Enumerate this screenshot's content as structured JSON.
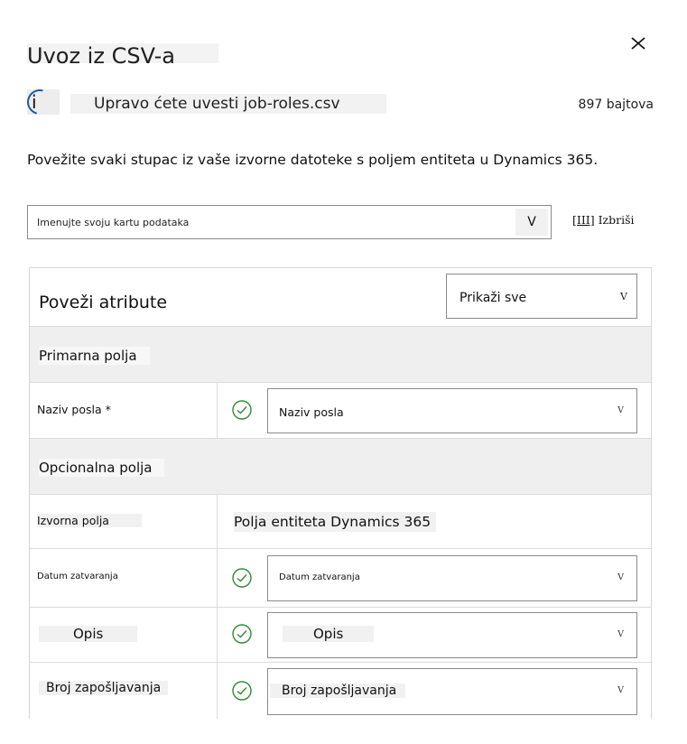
{
  "dialog": {
    "title": "Uvoz iz CSV-a",
    "file_note": "Upravo ćete uvesti job-roles.csv",
    "file_size": "897 bajtova",
    "info_icon_letter": "i",
    "instruction": "Povežite svaki stupac iz vaše izvorne datoteke s poljem entiteta u Dynamics 365."
  },
  "map_name": {
    "placeholder": "Imenujte svoju kartu podataka",
    "chevron": "V"
  },
  "delete": {
    "icon_text": "[III]",
    "label": "Izbriši"
  },
  "panel": {
    "title": "Poveži atribute",
    "show_select": {
      "value": "Prikaži sve",
      "chevron": "V"
    },
    "primary_section": "Primarna polja",
    "optional_section": "Opcionalna polja",
    "column_headers": {
      "source": "Izvorna polja",
      "target": "Polja entiteta Dynamics 365"
    },
    "rows": [
      {
        "source": "Naziv posla *",
        "target": "Naziv posla",
        "chevron": "V"
      },
      {
        "source": "Datum zatvaranja",
        "target": "Datum zatvaranja",
        "chevron": "V"
      },
      {
        "source": "Opis",
        "target": "Opis",
        "chevron": "V"
      },
      {
        "source": "Broj zapošljavanja",
        "target": "Broj zapošljavanja",
        "chevron": "V"
      }
    ]
  },
  "colors": {
    "accent": "#1c5aa6",
    "success": "#2e8b35",
    "border": "#8a8a8a",
    "section_bg": "#efefef"
  },
  "icons": [
    "close-icon",
    "info-icon",
    "chevron-down-icon",
    "trash-icon",
    "checkmark-circle-icon"
  ]
}
